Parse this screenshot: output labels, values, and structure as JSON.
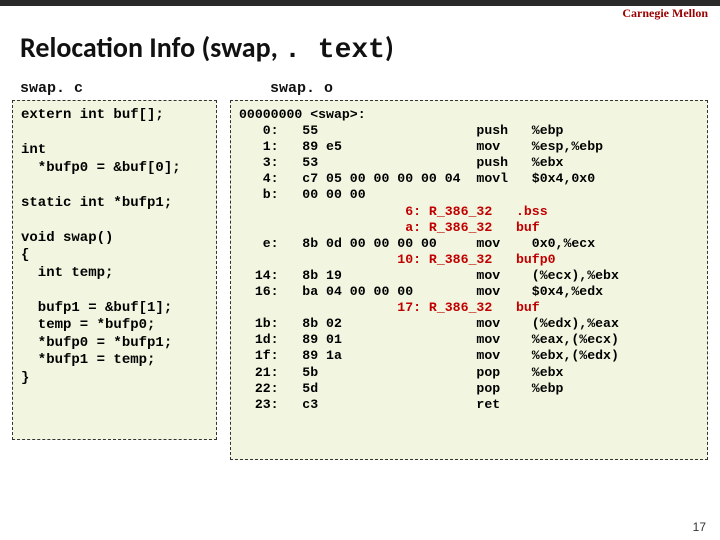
{
  "brand": "Carnegie Mellon",
  "title_prefix": "Relocation Info (swap, ",
  "title_mono": ". text",
  "title_suffix": ")",
  "label_c": "swap. c",
  "label_o": "swap. o",
  "code_c": "extern int buf[];\n\nint\n  *bufp0 = &buf[0];\n\nstatic int *bufp1;\n\nvoid swap()\n{\n  int temp;\n\n  bufp1 = &buf[1];\n  temp = *bufp0;\n  *bufp0 = *bufp1;\n  *bufp1 = temp;\n}",
  "obj": {
    "head": "00000000 <swap>:",
    "l0": "   0:   55                    push   %ebp",
    "l1": "   1:   89 e5                 mov    %esp,%ebp",
    "l3": "   3:   53                    push   %ebx",
    "l4": "   4:   c7 05 00 00 00 00 04  movl   $0x4,0x0",
    "lb": "   b:   00 00 00",
    "r6": "                     6: R_386_32   .bss",
    "ra": "                     a: R_386_32   buf",
    "le": "   e:   8b 0d 00 00 00 00     mov    0x0,%ecx",
    "r10": "                    10: R_386_32   bufp0",
    "l14": "  14:   8b 19                 mov    (%ecx),%ebx",
    "l16": "  16:   ba 04 00 00 00        mov    $0x4,%edx",
    "r17": "                    17: R_386_32   buf",
    "l1b": "  1b:   8b 02                 mov    (%edx),%eax",
    "l1d": "  1d:   89 01                 mov    %eax,(%ecx)",
    "l1f": "  1f:   89 1a                 mov    %ebx,(%edx)",
    "l21": "  21:   5b                    pop    %ebx",
    "l22": "  22:   5d                    pop    %ebp",
    "l23": "  23:   c3                    ret"
  },
  "pagenum": "17"
}
